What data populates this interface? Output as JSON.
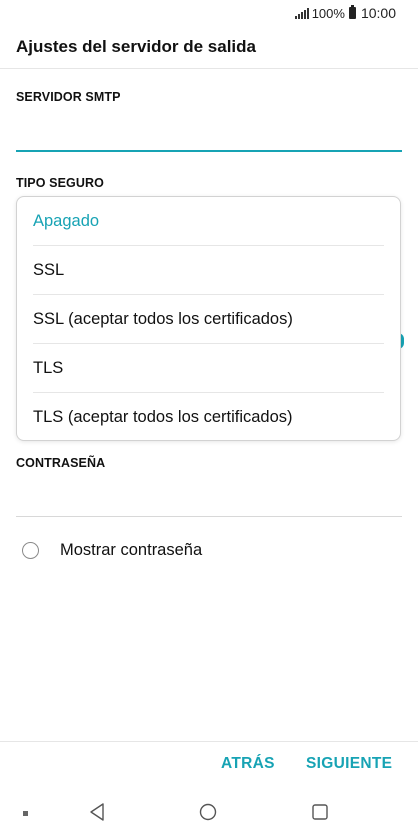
{
  "status_bar": {
    "battery": "100%",
    "time": "10:00"
  },
  "page_title": "Ajustes del servidor de salida",
  "smtp_server": {
    "label": "SERVIDOR SMTP",
    "value": ""
  },
  "security_type": {
    "label": "TIPO SEGURO",
    "options": [
      "Apagado",
      "SSL",
      "SSL (aceptar todos los certificados)",
      "TLS",
      "TLS (aceptar todos los certificados)"
    ],
    "selected": "Apagado"
  },
  "password": {
    "label": "CONTRASEÑA",
    "value": ""
  },
  "show_password_label": "Mostrar contraseña",
  "footer": {
    "back_label": "ATRÁS",
    "next_label": "SIGUIENTE"
  },
  "colors": {
    "accent": "#17a3b4",
    "text": "#111111",
    "divider": "#e6e6e6"
  },
  "nav_icons": [
    "menu-dot-icon",
    "back-triangle-icon",
    "home-circle-icon",
    "recents-square-icon"
  ]
}
